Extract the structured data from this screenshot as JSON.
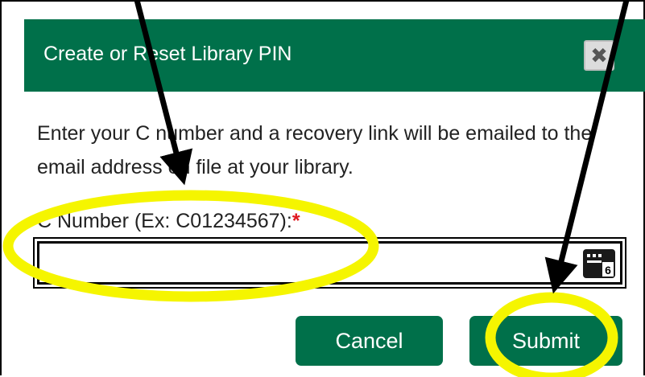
{
  "dialog": {
    "title": "Create or Reset Library PIN",
    "close_icon": "close-icon",
    "instructions": "Enter your C number and a recovery link will be emailed to the email address on file at your library.",
    "field_label": "C Number (Ex: C01234567):",
    "required_mark": "*",
    "input_value": "",
    "keypad_icon": "keypad-icon",
    "keypad_digit": "6",
    "cancel_label": "Cancel",
    "submit_label": "Submit"
  },
  "colors": {
    "header": "#00704a",
    "button": "#00704a",
    "required": "#e0181e",
    "highlight": "#f5f500",
    "arrow": "#000000"
  }
}
